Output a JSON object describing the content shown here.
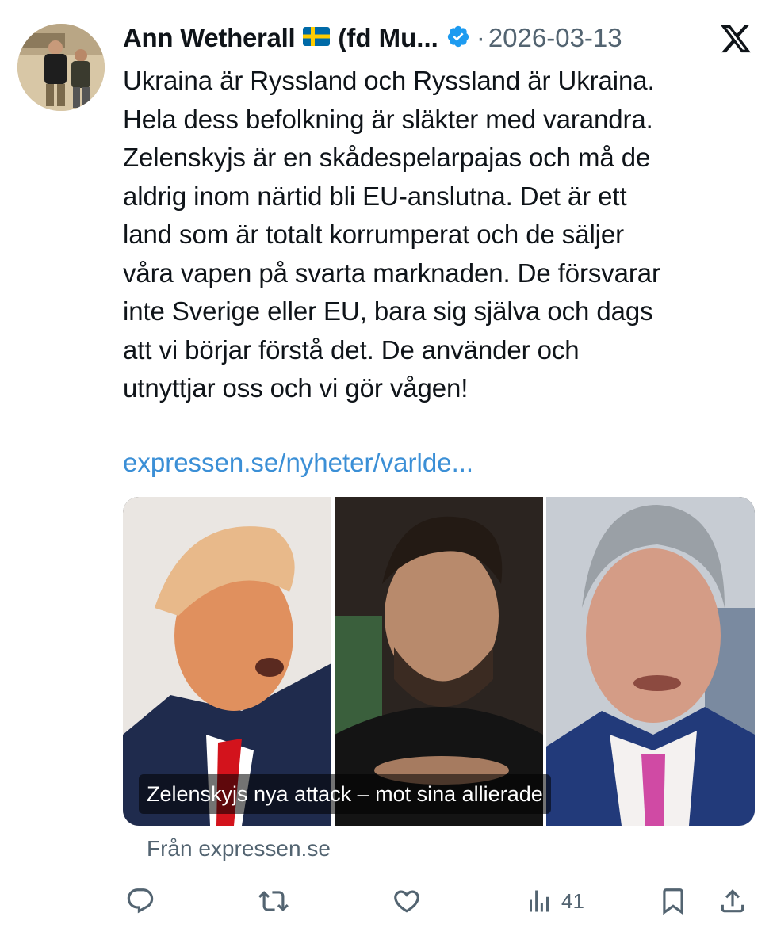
{
  "author": {
    "name": "Ann Wetherall",
    "flag": "sweden-flag",
    "name_suffix": "(fd Mu...",
    "verified_icon": "verified-badge-icon",
    "separator": "·",
    "date": "2026-03-13"
  },
  "platform_icon": "x-logo-icon",
  "tweet": {
    "text": "Ukraina är Ryssland och Ryssland är Ukraina.\nHela dess befolkning är släkter med varandra.\nZelenskyjs är en skådespelarpajas och må de\naldrig  inom närtid bli EU-anslutna. Det är ett\nland som är totalt korrumperat och de säljer\nvåra vapen på svarta marknaden. De försvarar\ninte Sverige eller EU, bara sig själva och dags\natt vi börjar förstå det. De använder och\nutnyttjar oss och vi gör vågen!",
    "link": "expressen.se/nyheter/varlde..."
  },
  "card": {
    "caption": "Zelenskyjs nya attack – mot sina allierade",
    "source": "Från expressen.se"
  },
  "actions": {
    "reply_icon": "reply-icon",
    "retweet_icon": "retweet-icon",
    "like_icon": "like-icon",
    "views_icon": "views-icon",
    "views": "41",
    "bookmark_icon": "bookmark-icon",
    "share_icon": "share-icon"
  },
  "colors": {
    "link": "#3b8fd6",
    "verified": "#1d9bf0",
    "muted": "#536471",
    "text": "#0f1419"
  }
}
